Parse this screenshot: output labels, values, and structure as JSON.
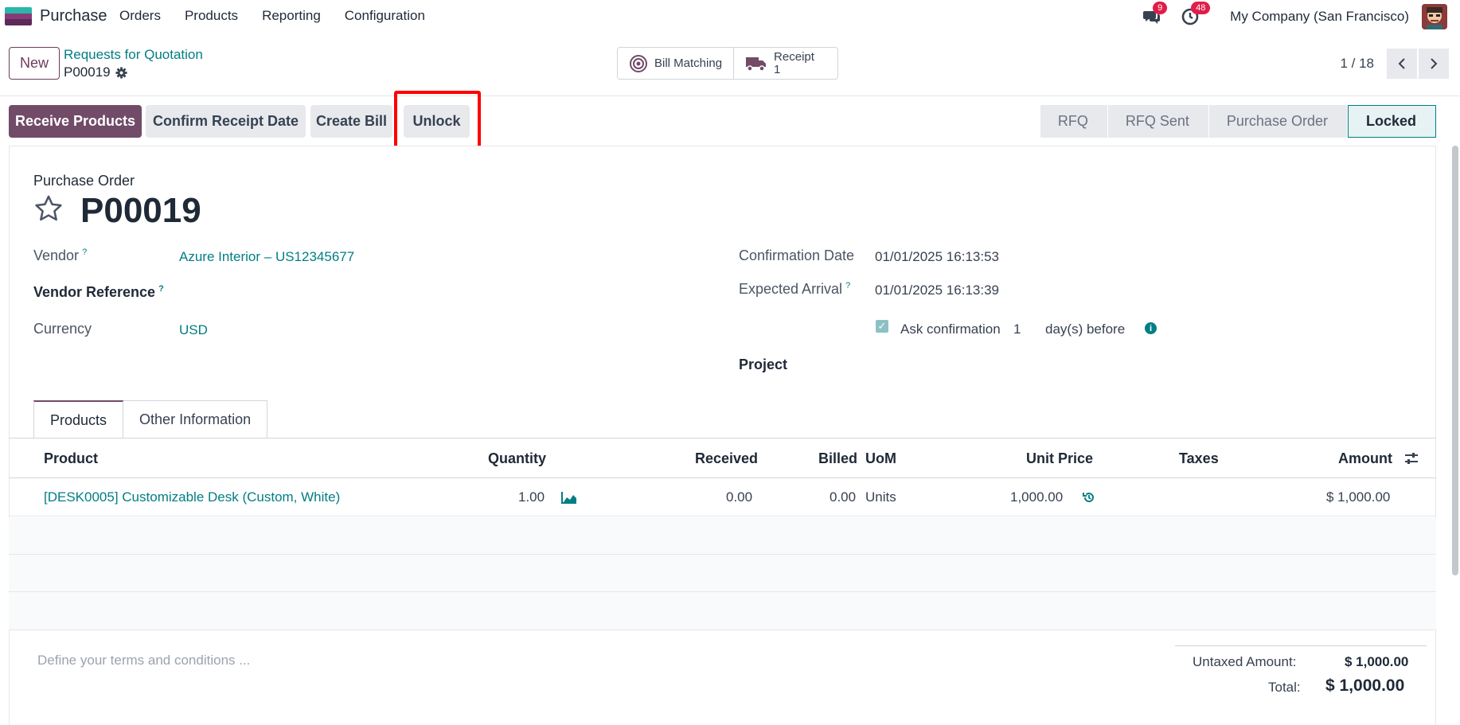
{
  "navbar": {
    "app_name": "Purchase",
    "menu": [
      "Orders",
      "Products",
      "Reporting",
      "Configuration"
    ],
    "messages_count": "9",
    "activities_count": "48",
    "company": "My Company (San Francisco)"
  },
  "control_panel": {
    "new_label": "New",
    "breadcrumb": "Requests for Quotation",
    "record_name": "P00019",
    "bill_matching_label": "Bill Matching",
    "receipt_label": "Receipt",
    "receipt_count": "1",
    "pager_value": "1 / 18"
  },
  "statusbar": {
    "buttons": [
      "Receive Products",
      "Confirm Receipt Date",
      "Create Bill",
      "Unlock"
    ],
    "stages": [
      "RFQ",
      "RFQ Sent",
      "Purchase Order",
      "Locked"
    ],
    "active_stage": "Locked"
  },
  "form": {
    "type_label": "Purchase Order",
    "name": "P00019",
    "vendor_label": "Vendor",
    "vendor_value": "Azure Interior – US12345677",
    "vendor_ref_label": "Vendor Reference",
    "currency_label": "Currency",
    "currency_value": "USD",
    "confirmation_date_label": "Confirmation Date",
    "confirmation_date_value": "01/01/2025 16:13:53",
    "expected_arrival_label": "Expected Arrival",
    "expected_arrival_value": "01/01/2025 16:13:39",
    "ask_confirmation_label": "Ask confirmation",
    "ask_confirmation_days": "1",
    "days_before_label": "day(s) before",
    "project_label": "Project",
    "help_mark": "?"
  },
  "tabs": [
    "Products",
    "Other Information"
  ],
  "table": {
    "headers": [
      "Product",
      "Quantity",
      "Received",
      "Billed",
      "UoM",
      "Unit Price",
      "Taxes",
      "Amount"
    ],
    "rows": [
      {
        "product": "[DESK0005] Customizable Desk (Custom, White)",
        "quantity": "1.00",
        "received": "0.00",
        "billed": "0.00",
        "uom": "Units",
        "unit_price": "1,000.00",
        "taxes": "",
        "amount": "$ 1,000.00"
      }
    ]
  },
  "footer": {
    "terms_placeholder": "Define your terms and conditions ...",
    "untaxed_label": "Untaxed Amount:",
    "untaxed_value": "$ 1,000.00",
    "total_label": "Total:",
    "total_value": "$ 1,000.00"
  },
  "colors": {
    "primary": "#714b67",
    "link": "#017e84",
    "badge": "#e11d48",
    "highlight": "#ff0000"
  }
}
